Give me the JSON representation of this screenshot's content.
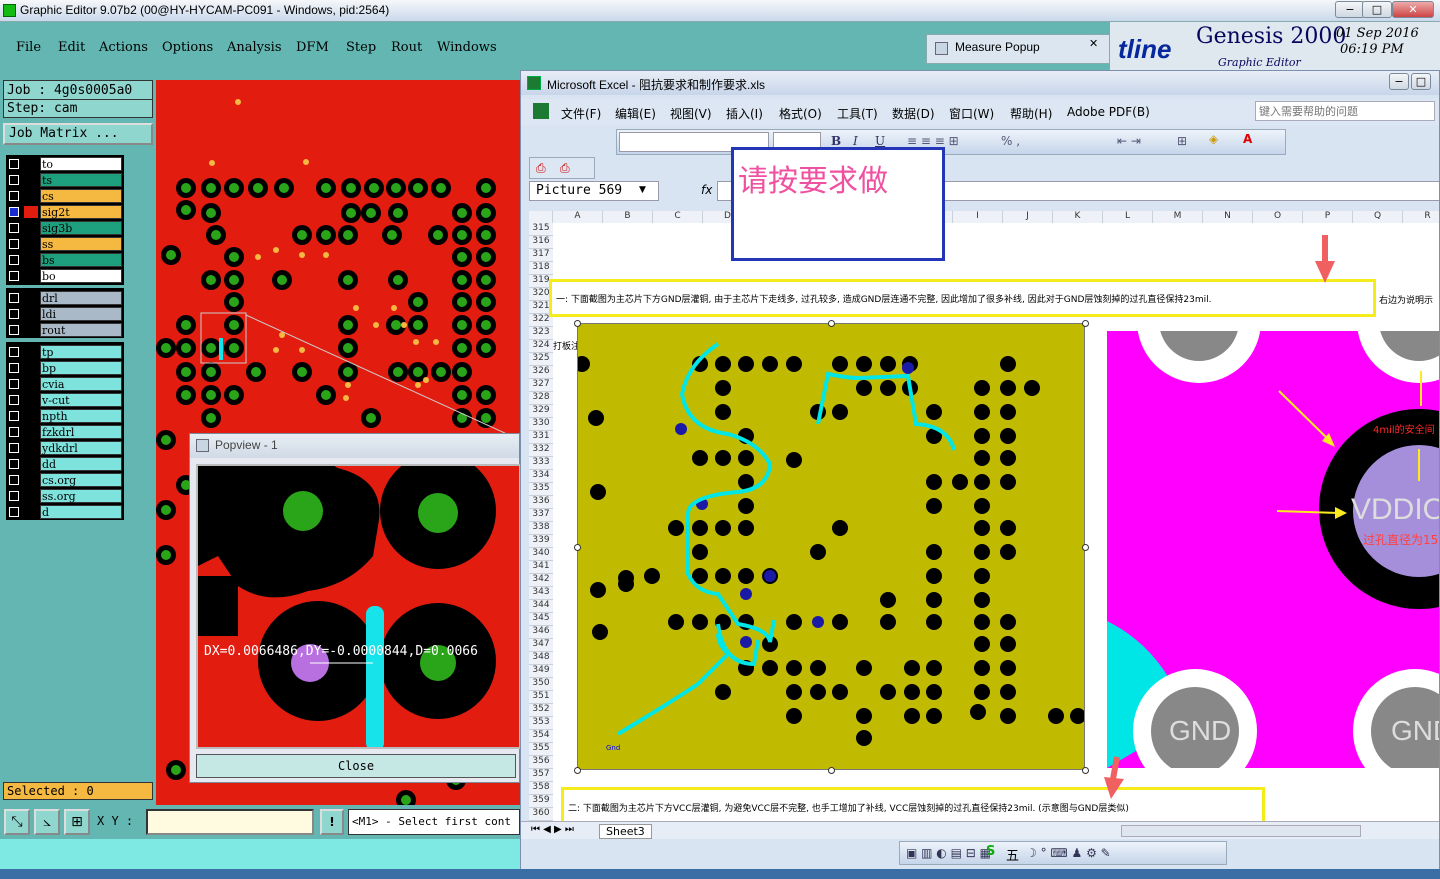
{
  "window": {
    "title": "Graphic Editor 9.07b2 (00@HY-HYCAM-PC091 - Windows, pid:2564)"
  },
  "menu": [
    "File",
    "Edit",
    "Actions",
    "Options",
    "Analysis",
    "DFM",
    "Step",
    "Rout",
    "Windows"
  ],
  "brand": {
    "logo_partial": "tline",
    "product": "Genesis 2000",
    "date_line1": "01 Sep 2016",
    "date_line2": "06:19 PM",
    "sub": "Graphic Editor"
  },
  "measure_popup": {
    "title": "Measure Popup"
  },
  "job": {
    "job_line": "Job : 4g0s0005a0",
    "step_line": "Step: cam",
    "matrix_label": "Job Matrix ..."
  },
  "layers": [
    {
      "name": "to",
      "color": "#ffffff"
    },
    {
      "name": "ts",
      "color": "#1ea07f"
    },
    {
      "name": "cs",
      "color": "#f5b840"
    },
    {
      "name": "sig2t",
      "color": "#f5b840",
      "selected": true
    },
    {
      "name": "sig3b",
      "color": "#1ea07f"
    },
    {
      "name": "ss",
      "color": "#f5b840"
    },
    {
      "name": "bs",
      "color": "#1ea07f"
    },
    {
      "name": "bo",
      "color": "#ffffff"
    },
    {
      "name": "drl",
      "color": "#a9b9c7"
    },
    {
      "name": "ldi",
      "color": "#a9b9c7"
    },
    {
      "name": "rout",
      "color": "#a9b9c7"
    },
    {
      "name": "tp",
      "color": "#7fe3dd"
    },
    {
      "name": "bp",
      "color": "#7fe3dd"
    },
    {
      "name": "cvia",
      "color": "#7fe3dd"
    },
    {
      "name": "v-cut",
      "color": "#7fe3dd"
    },
    {
      "name": "npth",
      "color": "#7fe3dd"
    },
    {
      "name": "fzkdrl",
      "color": "#7fe3dd"
    },
    {
      "name": "ydkdrl",
      "color": "#7fe3dd"
    },
    {
      "name": "dd",
      "color": "#7fe3dd"
    },
    {
      "name": "cs.org",
      "color": "#7fe3dd"
    },
    {
      "name": "ss.org",
      "color": "#7fe3dd"
    },
    {
      "name": "d",
      "color": "#7fe3dd"
    }
  ],
  "selected_count": "Selected : 0",
  "xy_label": "X Y :",
  "prompt": "<M1> - Select first cont",
  "popview": {
    "title": "Popview - 1",
    "measure": "DX=0.0066486,DY=-0.0000844,D=0.0066",
    "close": "Close"
  },
  "excel": {
    "title": "Microsoft Excel - 阻抗要求和制作要求.xls",
    "menu": [
      "文件(F)",
      "编辑(E)",
      "视图(V)",
      "插入(I)",
      "格式(O)",
      "工具(T)",
      "数据(D)",
      "窗口(W)",
      "帮助(H)",
      "Adobe PDF(B)"
    ],
    "help_placeholder": "键入需要帮助的问题",
    "name_box": "Picture 569",
    "fx": "fx",
    "note_box": "请按要求做",
    "columns": [
      "A",
      "B",
      "C",
      "D",
      "E",
      "F",
      "G",
      "H",
      "I",
      "J",
      "K",
      "L",
      "M",
      "N",
      "O",
      "P",
      "Q",
      "R"
    ],
    "row_start": 315,
    "row_319_text": "打板注意事项:",
    "note1": "一: 下面截图为主芯片下方GND层灌铜, 由于主芯片下走线多, 过孔较多, 造成GND层连通不完整, 因此增加了很多补线, 因此对于GND层蚀刻掉的过孔直径保持23mil.",
    "note1_tail": "右边为说明示",
    "note2": "二: 下面截图为主芯片下方VCC层灌铜, 为避免VCC层不完整, 也手工增加了补线, VCC层蚀刻掉的过孔直径保持23mil. (示意图与GND层类似)",
    "sheet_tab": "Sheet3",
    "magenta_labels": {
      "safety": "4mil的安全间",
      "via": "VDDIO_A",
      "via_dia": "过孔直径为15",
      "gnd": "GND"
    },
    "trace_label": "Gnd"
  },
  "colors": {
    "teal": "#63b6b1",
    "pcb_red": "#e31c10",
    "olive": "#c0bb00",
    "magenta": "#ff00ff",
    "highlight": "#f4ec1c"
  }
}
